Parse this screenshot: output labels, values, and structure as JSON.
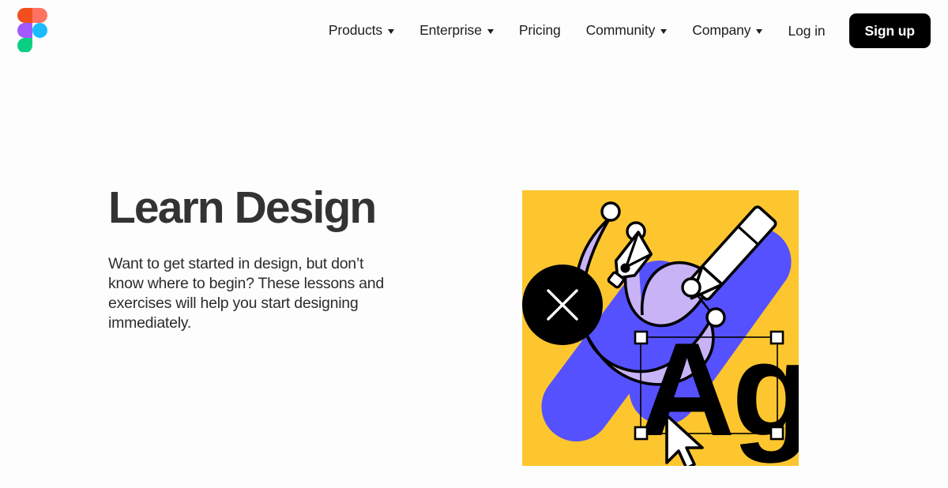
{
  "page": {
    "background_color": "#fdfdfd",
    "text_color": "#1e1e1e"
  },
  "header": {
    "logo": {
      "name": "figma-logo",
      "colors": {
        "red": "#f24e1e",
        "orange": "#ff7262",
        "purple": "#a259ff",
        "blue": "#1abcfe",
        "green": "#0acf83"
      }
    },
    "nav_items": [
      {
        "label": "Products",
        "has_dropdown": true
      },
      {
        "label": "Enterprise",
        "has_dropdown": true
      },
      {
        "label": "Pricing",
        "has_dropdown": false
      },
      {
        "label": "Community",
        "has_dropdown": true
      },
      {
        "label": "Company",
        "has_dropdown": true
      }
    ],
    "login_label": "Log in",
    "signup_label": "Sign up",
    "signup_bg": "#000000",
    "signup_fg": "#ffffff"
  },
  "hero": {
    "title": "Learn Design",
    "body": "Want to get started in design, but don’t know where to begin? These lessons and exercises will help you start designing immediately.",
    "illustration": {
      "name": "learn-design-illustration",
      "background_color": "#fdc62e",
      "blue": "#5551ff",
      "light_purple": "#c9b3f7",
      "black": "#000000",
      "white": "#ffffff",
      "glyph_text": "Ag",
      "elements": [
        "close-circle-icon",
        "pen-tool-icon",
        "pencil-icon",
        "type-glyph-Ag",
        "selection-box",
        "cursor-arrow-icon",
        "vector-path-nodes"
      ]
    }
  }
}
